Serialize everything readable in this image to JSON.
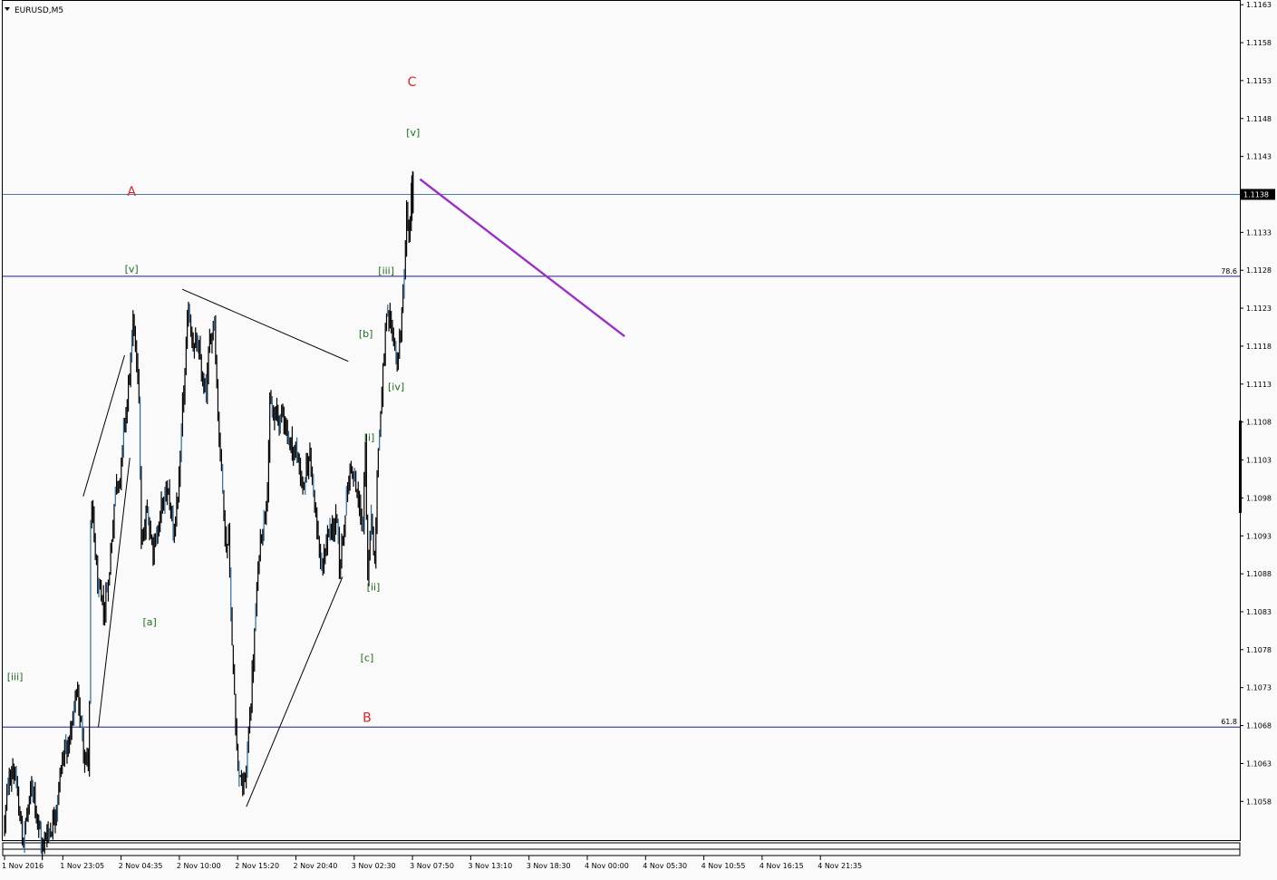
{
  "window": {
    "title": "EURUSD,M5",
    "menu_icon": "triangle-down-icon"
  },
  "colors": {
    "background": "#fafafa",
    "candles": "#000000",
    "hline": "#1a1a8c",
    "price_line": "#4a7ab5",
    "wave_major": "#e0202a",
    "wave_minor": "#1e6e1e",
    "projection": "#9b30c8"
  },
  "current_price": "1.1138",
  "fib_levels": [
    {
      "label": "78.6",
      "price": 1.11272
    },
    {
      "label": "61.8",
      "price": 1.10678
    }
  ],
  "wave_labels": [
    {
      "text": "A",
      "kind": "major",
      "t": 2.18,
      "price": 1.11378
    },
    {
      "text": "B",
      "kind": "major",
      "t": 6.22,
      "price": 1.10685
    },
    {
      "text": "C",
      "kind": "major",
      "t": 6.99,
      "price": 1.11523
    },
    {
      "text": "[iii]",
      "kind": "minor",
      "t": 0.18,
      "price": 1.1074
    },
    {
      "text": "[v]",
      "kind": "minor",
      "t": 2.18,
      "price": 1.11277
    },
    {
      "text": "[a]",
      "kind": "minor",
      "t": 2.49,
      "price": 1.10812
    },
    {
      "text": "[b]",
      "kind": "minor",
      "t": 6.2,
      "price": 1.11192
    },
    {
      "text": "[c]",
      "kind": "minor",
      "t": 6.22,
      "price": 1.10765
    },
    {
      "text": "[i]",
      "kind": "minor",
      "t": 6.26,
      "price": 1.11055
    },
    {
      "text": "[ii]",
      "kind": "minor",
      "t": 6.33,
      "price": 1.10858
    },
    {
      "text": "[iii]",
      "kind": "minor",
      "t": 6.55,
      "price": 1.11275
    },
    {
      "text": "[iv]",
      "kind": "minor",
      "t": 6.72,
      "price": 1.11122
    },
    {
      "text": "[v]",
      "kind": "minor",
      "t": 7.01,
      "price": 1.11457
    }
  ],
  "chart_data": {
    "type": "candlestick",
    "symbol": "EURUSD",
    "timeframe": "M5",
    "ylim": [
      1.10529,
      1.11635
    ],
    "y_ticks": [
      "1.1163",
      "1.1158",
      "1.1153",
      "1.1148",
      "1.1143",
      "1.1138",
      "1.1133",
      "1.1128",
      "1.1123",
      "1.1118",
      "1.1113",
      "1.1108",
      "1.1103",
      "1.1098",
      "1.1093",
      "1.1088",
      "1.1083",
      "1.1078",
      "1.1073",
      "1.1068",
      "1.1063",
      "1.1058"
    ],
    "x_ticks": [
      "1 Nov 2016",
      "1 Nov 23:05",
      "2 Nov 04:35",
      "2 Nov 10:00",
      "2 Nov 15:20",
      "2 Nov 20:40",
      "3 Nov 02:30",
      "3 Nov 07:50",
      "3 Nov 13:10",
      "3 Nov 18:30",
      "4 Nov 00:00",
      "4 Nov 05:30",
      "4 Nov 10:55",
      "4 Nov 16:15",
      "4 Nov 21:35"
    ],
    "path": [
      [
        0.0,
        1.1055
      ],
      [
        0.15,
        1.1064
      ],
      [
        0.3,
        1.1053
      ],
      [
        0.5,
        1.106
      ],
      [
        0.65,
        1.1052
      ],
      [
        0.85,
        1.1057
      ],
      [
        0.95,
        1.1064
      ],
      [
        1.15,
        1.1067
      ],
      [
        1.25,
        1.1072
      ],
      [
        1.35,
        1.1066
      ],
      [
        1.45,
        1.1064
      ],
      [
        1.48,
        1.1097
      ],
      [
        1.6,
        1.1085
      ],
      [
        1.7,
        1.108
      ],
      [
        1.8,
        1.1088
      ],
      [
        1.9,
        1.11
      ],
      [
        2.0,
        1.1104
      ],
      [
        2.1,
        1.111
      ],
      [
        2.2,
        1.1119
      ],
      [
        2.3,
        1.1113
      ],
      [
        2.35,
        1.109
      ],
      [
        2.45,
        1.1095
      ],
      [
        2.55,
        1.1092
      ],
      [
        2.65,
        1.1096
      ],
      [
        2.8,
        1.1098
      ],
      [
        2.9,
        1.1093
      ],
      [
        3.0,
        1.11
      ],
      [
        3.1,
        1.1113
      ],
      [
        3.15,
        1.112
      ],
      [
        3.3,
        1.1118
      ],
      [
        3.4,
        1.1112
      ],
      [
        3.45,
        1.111
      ],
      [
        3.55,
        1.1118
      ],
      [
        3.6,
        1.1122
      ],
      [
        3.65,
        1.1112
      ],
      [
        3.72,
        1.1103
      ],
      [
        3.8,
        1.1093
      ],
      [
        3.85,
        1.1095
      ],
      [
        3.9,
        1.108
      ],
      [
        4.0,
        1.1065
      ],
      [
        4.08,
        1.106
      ],
      [
        4.15,
        1.1062
      ],
      [
        4.25,
        1.1075
      ],
      [
        4.35,
        1.1088
      ],
      [
        4.4,
        1.1093
      ],
      [
        4.5,
        1.11
      ],
      [
        4.55,
        1.1112
      ],
      [
        4.6,
        1.1109
      ],
      [
        4.7,
        1.1108
      ],
      [
        4.8,
        1.1108
      ],
      [
        4.9,
        1.1106
      ],
      [
        5.05,
        1.1103
      ],
      [
        5.15,
        1.1099
      ],
      [
        5.25,
        1.1104
      ],
      [
        5.35,
        1.1096
      ],
      [
        5.45,
        1.1088
      ],
      [
        5.55,
        1.1094
      ],
      [
        5.7,
        1.1094
      ],
      [
        5.75,
        1.1086
      ],
      [
        5.85,
        1.1097
      ],
      [
        5.95,
        1.1103
      ],
      [
        6.05,
        1.1097
      ],
      [
        6.15,
        1.1094
      ],
      [
        6.2,
        1.1106
      ],
      [
        6.22,
        1.1082
      ],
      [
        6.28,
        1.1096
      ],
      [
        6.35,
        1.109
      ],
      [
        6.4,
        1.1104
      ],
      [
        6.45,
        1.111
      ],
      [
        6.5,
        1.1115
      ],
      [
        6.55,
        1.1121
      ],
      [
        6.6,
        1.1118
      ],
      [
        6.7,
        1.1116
      ],
      [
        6.75,
        1.1115
      ],
      [
        6.85,
        1.1125
      ],
      [
        6.9,
        1.1135
      ],
      [
        6.95,
        1.1131
      ],
      [
        7.0,
        1.1138
      ]
    ],
    "trendlines": [
      {
        "from": [
          1.35,
          1.10982
        ],
        "to": [
          2.06,
          1.11168
        ]
      },
      {
        "from": [
          1.61,
          1.10678
        ],
        "to": [
          2.15,
          1.11033
        ]
      },
      {
        "from": [
          3.05,
          1.11255
        ],
        "to": [
          5.9,
          1.1116
        ]
      },
      {
        "from": [
          4.15,
          1.10573
        ],
        "to": [
          5.8,
          1.10876
        ]
      },
      {
        "from": [
          7.13,
          1.114
        ],
        "to": [
          10.64,
          1.11193
        ]
      }
    ]
  }
}
